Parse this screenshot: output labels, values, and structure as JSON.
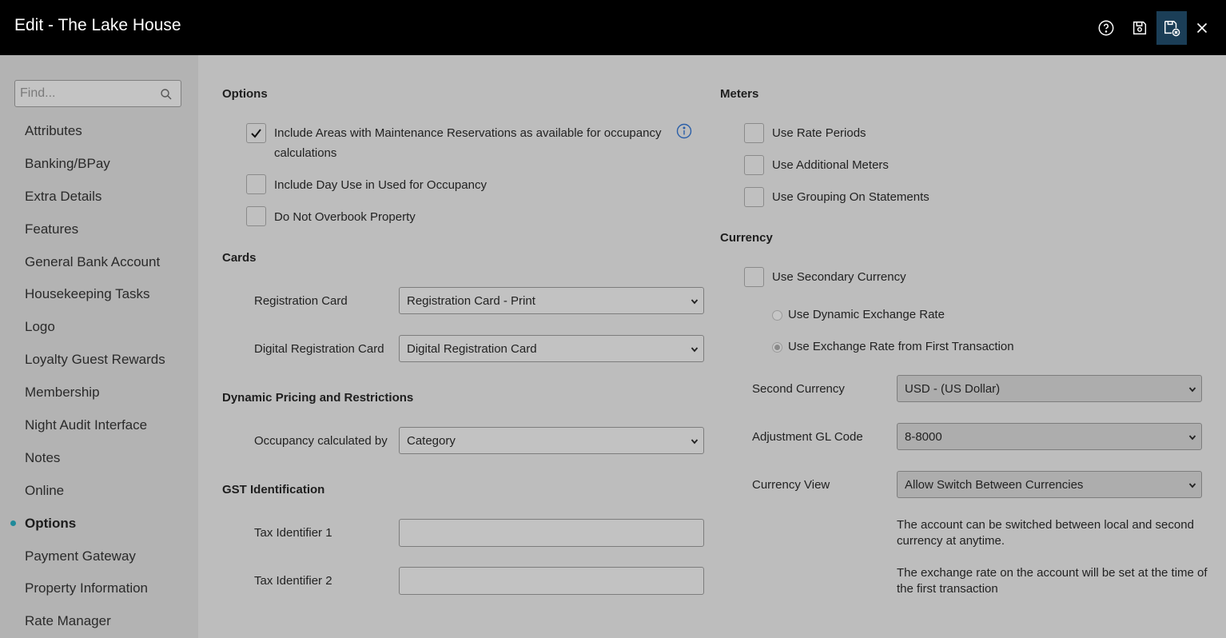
{
  "header": {
    "title": "Edit - The Lake House"
  },
  "toolbar": {
    "help_icon": "help-circle",
    "save_icon": "save",
    "save_close_icon": "save-and-close",
    "close_icon": "close"
  },
  "sidebar": {
    "search_placeholder": "Find...",
    "items": [
      {
        "label": "Attributes"
      },
      {
        "label": "Banking/BPay"
      },
      {
        "label": "Extra Details"
      },
      {
        "label": "Features"
      },
      {
        "label": "General Bank Account"
      },
      {
        "label": "Housekeeping Tasks"
      },
      {
        "label": "Logo"
      },
      {
        "label": "Loyalty Guest Rewards"
      },
      {
        "label": "Membership"
      },
      {
        "label": "Night Audit Interface"
      },
      {
        "label": "Notes"
      },
      {
        "label": "Online"
      },
      {
        "label": "Options",
        "active": true
      },
      {
        "label": "Payment Gateway"
      },
      {
        "label": "Property Information"
      },
      {
        "label": "Rate Manager"
      }
    ]
  },
  "options": {
    "title": "Options",
    "include_areas_line1": "Include Areas with Maintenance Reservations as available for occupancy",
    "include_areas_line2": "calculations",
    "include_areas_checked": true,
    "include_day_use": "Include Day Use in Used for Occupancy",
    "do_not_overbook": "Do Not Overbook Property"
  },
  "cards": {
    "title": "Cards",
    "registration_label": "Registration Card",
    "registration_value": "Registration Card - Print",
    "digital_label": "Digital Registration Card",
    "digital_value": "Digital Registration Card"
  },
  "dynamic": {
    "title": "Dynamic Pricing and Restrictions",
    "occupancy_label": "Occupancy calculated by",
    "occupancy_value": "Category"
  },
  "gst": {
    "title": "GST Identification",
    "tax1_label": "Tax Identifier 1",
    "tax1_value": "",
    "tax2_label": "Tax Identifier 2",
    "tax2_value": ""
  },
  "meters": {
    "title": "Meters",
    "rate_periods": "Use Rate Periods",
    "additional_meters": "Use Additional Meters",
    "grouping": "Use Grouping On Statements"
  },
  "currency": {
    "title": "Currency",
    "use_secondary": "Use Secondary Currency",
    "dynamic_rate": "Use Dynamic Exchange Rate",
    "first_transaction": "Use Exchange Rate from First Transaction",
    "second_currency_label": "Second Currency",
    "second_currency_value": "USD - (US Dollar)",
    "gl_label": "Adjustment GL Code",
    "gl_value": "8-8000",
    "view_label": "Currency View",
    "view_value": "Allow Switch Between Currencies",
    "note1": "The account can be switched between local and second currency at anytime.",
    "note2": "The exchange rate on the account will be set at the time of the first transaction"
  },
  "colors": {
    "accent": "#1f8a9a",
    "header_bg": "#000000",
    "active_button": "#1b3e57"
  }
}
